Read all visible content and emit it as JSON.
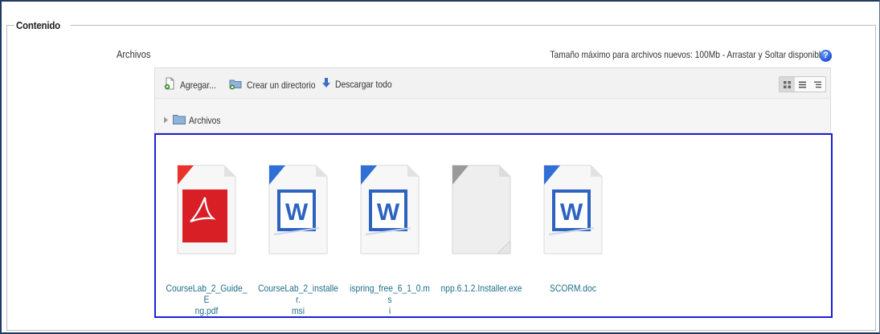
{
  "fieldset": {
    "legend": "Contenido"
  },
  "field": {
    "label": "Archivos",
    "max_size_text": "Tamaño máximo para archivos nuevos: 100Mb - Arrastar y Soltar disponible",
    "help_icon": "help-icon"
  },
  "toolbar": {
    "add_label": "Agregar...",
    "mkdir_label": "Crear un directorio",
    "download_label": "Descargar todo",
    "view_modes": [
      "icons",
      "list",
      "tree"
    ],
    "active_view": "icons"
  },
  "path": {
    "label": "Archivos"
  },
  "files": [
    {
      "name": "CourseLab_2_Guide_E\nng.pdf",
      "type": "pdf"
    },
    {
      "name": "CourseLab_2_installer.\nmsi",
      "type": "word"
    },
    {
      "name": "ispring_free_6_1_0.ms\ni",
      "type": "word"
    },
    {
      "name": "npp.6.1.2.Installer.exe",
      "type": "generic"
    },
    {
      "name": "SCORM.doc",
      "type": "word"
    }
  ],
  "colors": {
    "selection_border": "#1d1ed6",
    "link": "#1c6f8a",
    "frame": "#1f3a66"
  }
}
